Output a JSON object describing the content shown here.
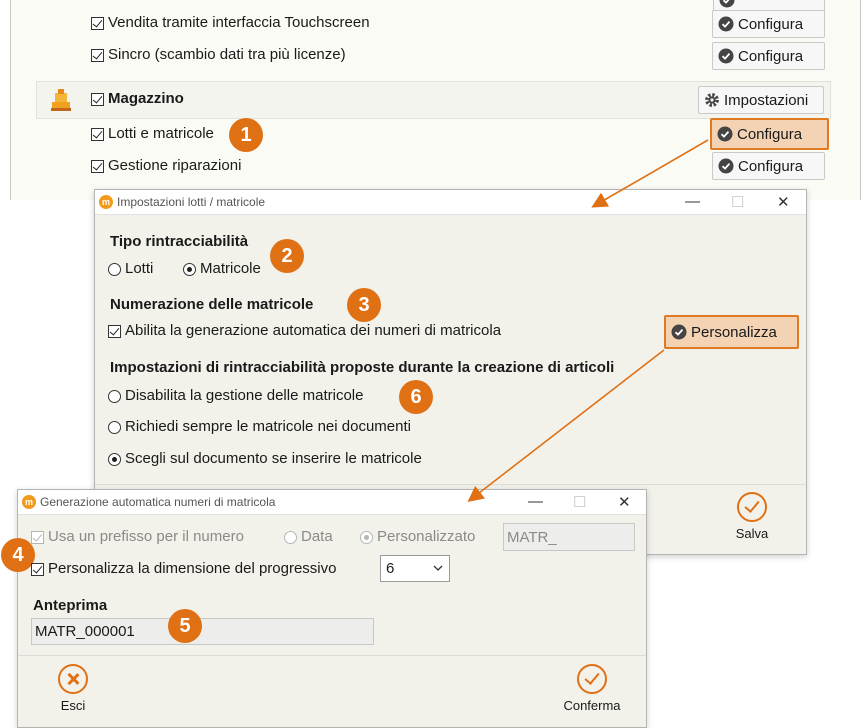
{
  "background": {
    "rows": [
      {
        "label": "Vendita tramite interfaccia Touchscreen",
        "button": "Configura"
      },
      {
        "label": "Sincro (scambio dati tra più licenze)",
        "button": "Configura"
      }
    ],
    "group": {
      "label": "Magazzino",
      "button": "Impostazioni"
    },
    "subrows": [
      {
        "label": "Lotti e matricole",
        "button": "Configura"
      },
      {
        "label": "Gestione riparazioni",
        "button": "Configura"
      }
    ]
  },
  "dialog1": {
    "title": "Impostazioni lotti / matricole",
    "tracking_heading": "Tipo rintracciabilità",
    "radio_lotti": "Lotti",
    "radio_matricole": "Matricole",
    "numbering_heading": "Numerazione delle matricole",
    "auto_checkbox": "Abilita la generazione automatica dei numeri di matricola",
    "personalize_button": "Personalizza",
    "proposed_heading": "Impostazioni di rintracciabilità proposte durante la creazione di articoli",
    "option1": "Disabilita la gestione delle matricole",
    "option2": "Richiedi sempre le matricole nei documenti",
    "option3": "Scegli sul documento se inserire le matricole",
    "save_label": "Salva"
  },
  "dialog2": {
    "title": "Generazione automatica numeri di matricola",
    "prefix_checkbox": "Usa un prefisso per il numero",
    "radio_data": "Data",
    "radio_custom": "Personalizzato",
    "prefix_value": "MATR_",
    "size_checkbox": "Personalizza la dimensione del progressivo",
    "size_value": "6",
    "preview_heading": "Anteprima",
    "preview_value": "MATR_000001",
    "exit_label": "Esci",
    "confirm_label": "Conferma"
  },
  "badges": [
    "1",
    "2",
    "3",
    "4",
    "5",
    "6"
  ],
  "colors": {
    "accent": "#e07014",
    "highlight_fill": "#f3d3b3",
    "window_bg": "#f2f1ea"
  },
  "icons": {
    "configure": "check-circle-icon",
    "settings": "gear-icon",
    "warehouse": "warehouse-icon",
    "save": "check-circle-icon",
    "exit": "x-circle-icon"
  }
}
